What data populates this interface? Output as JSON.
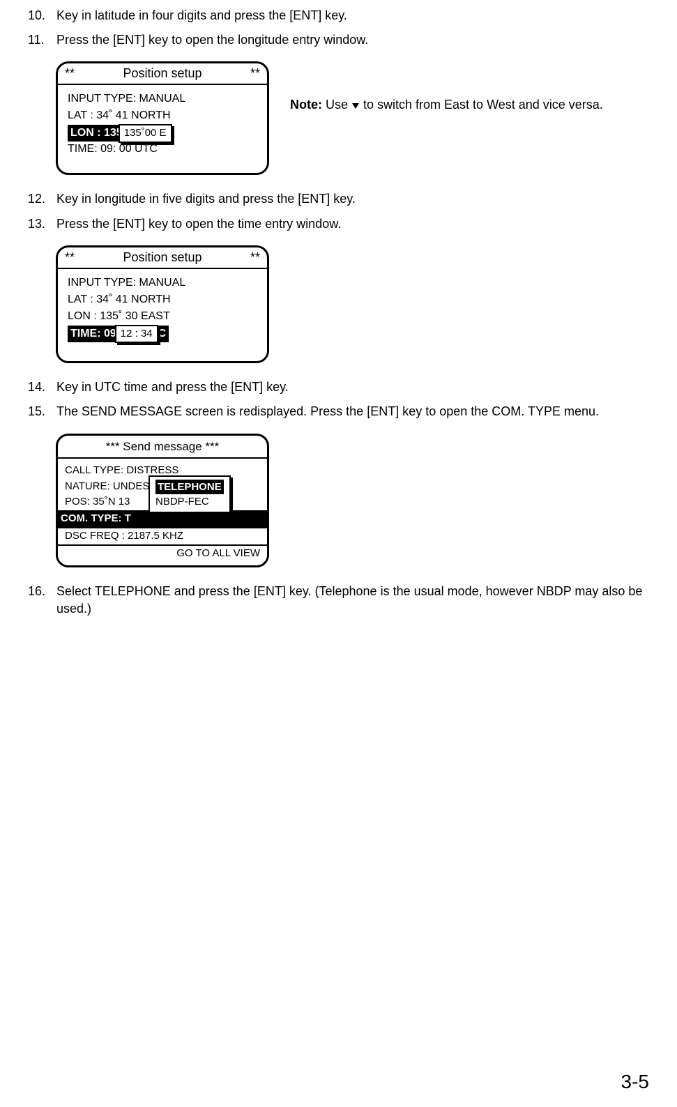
{
  "steps": {
    "s10_num": "10.",
    "s10_text": "Key in latitude in four digits and press the [ENT] key.",
    "s11_num": "11.",
    "s11_text": "Press the [ENT] key to open the longitude entry window.",
    "s12_num": "12.",
    "s12_text": "Key in longitude in five digits and press the [ENT] key.",
    "s13_num": "13.",
    "s13_text": "Press the [ENT] key to open the time entry window.",
    "s14_num": "14.",
    "s14_text": "Key in UTC time and press the [ENT] key.",
    "s15_num": "15.",
    "s15_text": "The SEND MESSAGE screen is redisplayed. Press the [ENT] key to open the COM. TYPE menu.",
    "s16_num": "16.",
    "s16_text": "Select TELEPHONE and press the [ENT] key. (Telephone is the usual mode, however NBDP may also be used.)"
  },
  "screen1": {
    "title_stars_l": "**",
    "title": "Position setup",
    "title_stars_r": "**",
    "input_type": "INPUT  TYPE: MANUAL",
    "lat": "LAT  :   34˚ 41 NORTH",
    "lon_hl_prefix": "LON : 135",
    "lon_popup": "135˚00 E",
    "time_under": "TIME:   09: 00 UTC"
  },
  "note1": {
    "label": "Note:",
    "text_before": " Use ",
    "text_after": " to switch from East to West and vice versa."
  },
  "screen2": {
    "title_stars_l": "**",
    "title": "Position setup",
    "title_stars_r": "**",
    "input_type": "INPUT  TYPE: MANUAL",
    "lat": "LAT  :   34˚ 41 NORTH",
    "lon": "LON : 135˚ 30 EAST",
    "time_hl_prefix": "TIME:   09",
    "time_popup": "12 : 34",
    "time_hl_suffix": "C"
  },
  "screen3": {
    "title": "*** Send message ***",
    "call_type": "CALL TYPE:      DISTRESS",
    "nature": "NATURE: UNDESIGNATED",
    "pos": "POS: 35˚N 13",
    "com_type": "COM. TYPE: T",
    "dsc_freq": "DSC FREQ :  2187.5 KHZ",
    "goto": "GO TO ALL VIEW",
    "popup_sel": "TELEPHONE",
    "popup_opt": "NBDP-FEC"
  },
  "page_number": "3-5"
}
